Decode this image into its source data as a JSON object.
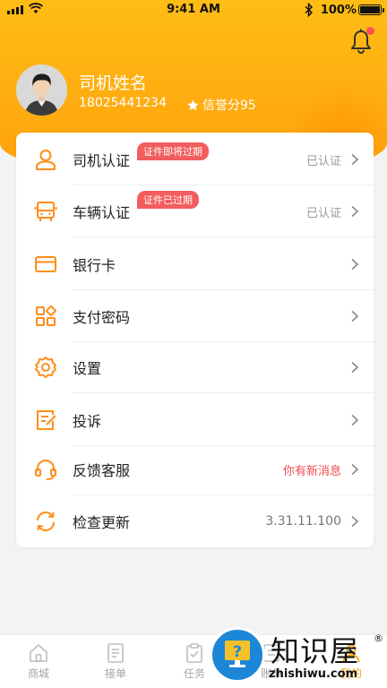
{
  "status_bar": {
    "time": "9:41 AM",
    "battery": "100%"
  },
  "profile": {
    "name": "司机姓名",
    "phone": "18025441234",
    "credit": "信誉分95"
  },
  "menu": [
    {
      "label": "司机认证",
      "icon": "user-icon",
      "value": "已认证",
      "tag": "证件即将过期"
    },
    {
      "label": "车辆认证",
      "icon": "bus-icon",
      "value": "已认证",
      "tag": "证件已过期"
    },
    {
      "label": "银行卡",
      "icon": "card-icon",
      "value": ""
    },
    {
      "label": "支付密码",
      "icon": "grid-icon",
      "value": ""
    },
    {
      "label": "设置",
      "icon": "gear-icon",
      "value": ""
    },
    {
      "label": "投诉",
      "icon": "complaint-icon",
      "value": ""
    },
    {
      "label": "反馈客服",
      "icon": "headset-icon",
      "value": "你有新消息"
    },
    {
      "label": "检查更新",
      "icon": "refresh-icon",
      "value": "3.31.11.100"
    }
  ],
  "tabs": [
    {
      "label": "商城",
      "icon": "home-icon"
    },
    {
      "label": "接单",
      "icon": "list-icon"
    },
    {
      "label": "任务",
      "icon": "clipboard-icon"
    },
    {
      "label": "账单",
      "icon": "bill-icon"
    },
    {
      "label": "我的",
      "icon": "profile-icon"
    }
  ],
  "watermark": {
    "text": "知识屋",
    "url": "zhishiwu.com",
    "reg": "®"
  },
  "colors": {
    "accent": "#ffa10d",
    "alert": "#f25d5d"
  }
}
